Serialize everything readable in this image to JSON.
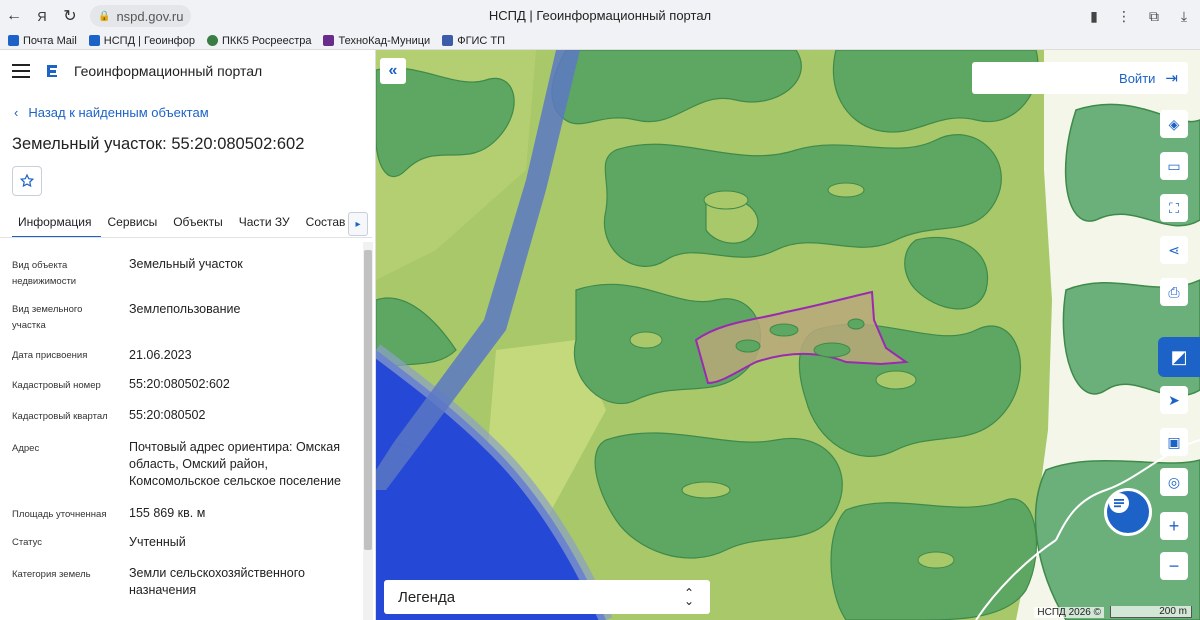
{
  "browser": {
    "url": "nspd.gov.ru",
    "tab_title": "НСПД | Геоинформационный портал",
    "bookmarks": [
      {
        "label": "Почта Mail",
        "color": "#1d63c7"
      },
      {
        "label": "НСПД | Геоинфор",
        "color": "#1d63c7"
      },
      {
        "label": "ПКК5 Росреестра",
        "color": "#3a7d44"
      },
      {
        "label": "ТехноКад-Муници",
        "color": "#6a2c8c"
      },
      {
        "label": "ФГИС ТП",
        "color": "#3c5ba8"
      }
    ]
  },
  "app": {
    "title": "Геоинформационный портал",
    "back_label": "Назад к найденным объектам",
    "object_title": "Земельный участок: 55:20:080502:602",
    "tabs": [
      "Информация",
      "Сервисы",
      "Объекты",
      "Части ЗУ",
      "Состав"
    ]
  },
  "fields": [
    {
      "label": "Вид объекта недвижимости",
      "value": "Земельный участок"
    },
    {
      "label": "Вид земельного участка",
      "value": "Землепользование"
    },
    {
      "label": "Дата присвоения",
      "value": "21.06.2023"
    },
    {
      "label": "Кадастровый номер",
      "value": "55:20:080502:602"
    },
    {
      "label": "Кадастровый квартал",
      "value": "55:20:080502"
    },
    {
      "label": "Адрес",
      "value": "Почтовый адрес ориентира: Омская область, Омский район, Комсомольское сельское поселение"
    },
    {
      "label": "Площадь уточненная",
      "value": "155 869 кв. м"
    },
    {
      "label": "Статус",
      "value": "Учтенный"
    },
    {
      "label": "Категория земель",
      "value": "Земли сельскохозяйственного назначения"
    }
  ],
  "map": {
    "login_label": "Войти",
    "legend_label": "Легенда",
    "copyright": "НСПД 2026 ©",
    "scale_label": "200 m",
    "colors": {
      "field": "#a8c86a",
      "forest": "#5ea762",
      "forest_edge": "#3f8a4a",
      "water": "#2548d6",
      "road": "#5c78c4",
      "parcel_fill": "#b8a87a",
      "parcel_edge": "#9a2bb0",
      "snow": "#f4f6ea",
      "accent": "#1d63c7"
    }
  }
}
